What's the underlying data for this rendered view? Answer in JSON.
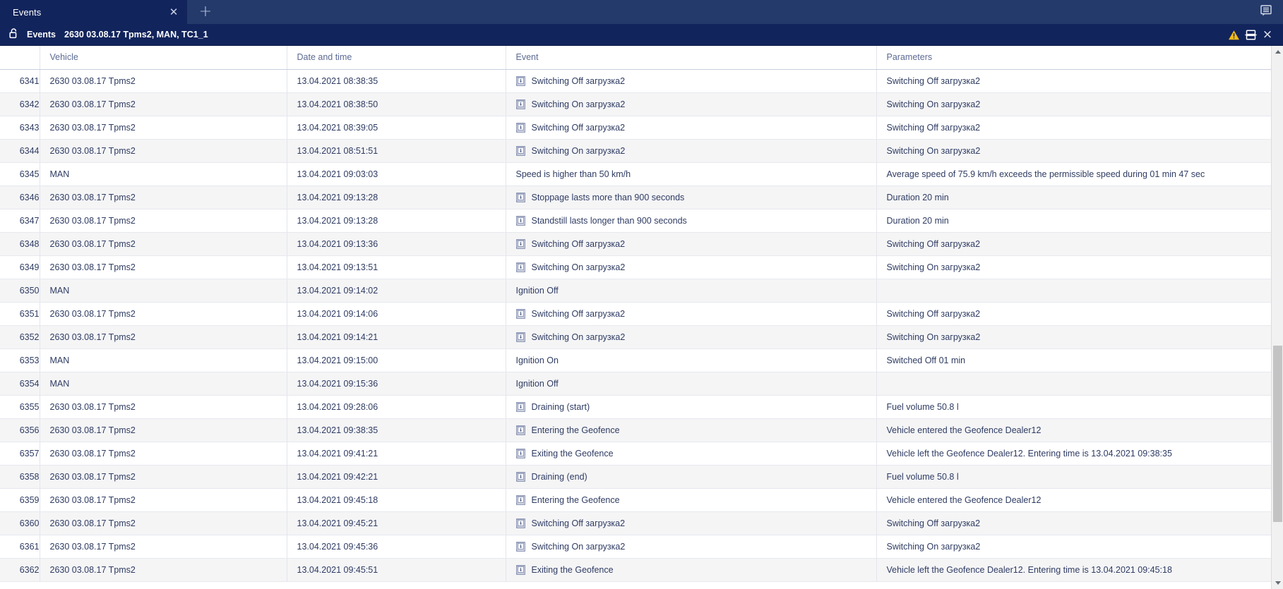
{
  "tabbar": {
    "tabs": [
      {
        "label": "Events",
        "close_icon": "close-icon",
        "active": true
      }
    ],
    "new_tab_icon": "plus-icon",
    "panel_toggle_icon": "panel-toggle-icon"
  },
  "titlebar": {
    "lock_icon": "unlocked-padlock-icon",
    "title": "Events",
    "subtitle": "2630 03.08.17 Tpms2, MAN, TC1_1",
    "warning_icon": "warning-triangle-icon",
    "layout_icon": "split-layout-icon",
    "close_icon": "close-icon",
    "close_label": "×"
  },
  "colors": {
    "tabbar_bg": "#243a6b",
    "tab_active_bg": "#12245c",
    "titlebar_bg": "#12245c",
    "text_on_dark": "#ffffff",
    "header_text": "#5d6a93",
    "cell_text": "#2f3c63",
    "row_even_bg": "#f5f5f6",
    "row_odd_bg": "#ffffff",
    "warning_yellow": "#f5bc18",
    "scroll_thumb": "#c3c3c3"
  },
  "table": {
    "columns": [
      {
        "key": "id",
        "label": ""
      },
      {
        "key": "vehicle",
        "label": "Vehicle"
      },
      {
        "key": "datetime",
        "label": "Date and time"
      },
      {
        "key": "event",
        "label": "Event"
      },
      {
        "key": "parameters",
        "label": "Parameters"
      }
    ],
    "rows": [
      {
        "id": "6341",
        "vehicle": "2630 03.08.17 Tpms2",
        "datetime": "13.04.2021 08:38:35",
        "icon": "sensor-event-icon",
        "event": "Switching Off загрузка2",
        "parameters": "Switching Off загрузка2"
      },
      {
        "id": "6342",
        "vehicle": "2630 03.08.17 Tpms2",
        "datetime": "13.04.2021 08:38:50",
        "icon": "sensor-event-icon",
        "event": "Switching On загрузка2",
        "parameters": "Switching On загрузка2"
      },
      {
        "id": "6343",
        "vehicle": "2630 03.08.17 Tpms2",
        "datetime": "13.04.2021 08:39:05",
        "icon": "sensor-event-icon",
        "event": "Switching Off загрузка2",
        "parameters": "Switching Off загрузка2"
      },
      {
        "id": "6344",
        "vehicle": "2630 03.08.17 Tpms2",
        "datetime": "13.04.2021 08:51:51",
        "icon": "sensor-event-icon",
        "event": "Switching On загрузка2",
        "parameters": "Switching On загрузка2"
      },
      {
        "id": "6345",
        "vehicle": "MAN",
        "datetime": "13.04.2021 09:03:03",
        "icon": "",
        "event": "Speed is higher than 50 km/h",
        "parameters": "Average speed of 75.9 km/h exceeds the permissible speed during 01 min 47 sec"
      },
      {
        "id": "6346",
        "vehicle": "2630 03.08.17 Tpms2",
        "datetime": "13.04.2021 09:13:28",
        "icon": "sensor-event-icon",
        "event": "Stoppage lasts more than 900 seconds",
        "parameters": "Duration 20 min"
      },
      {
        "id": "6347",
        "vehicle": "2630 03.08.17 Tpms2",
        "datetime": "13.04.2021 09:13:28",
        "icon": "sensor-event-icon",
        "event": "Standstill lasts longer than 900 seconds",
        "parameters": "Duration 20 min"
      },
      {
        "id": "6348",
        "vehicle": "2630 03.08.17 Tpms2",
        "datetime": "13.04.2021 09:13:36",
        "icon": "sensor-event-icon",
        "event": "Switching Off загрузка2",
        "parameters": "Switching Off загрузка2"
      },
      {
        "id": "6349",
        "vehicle": "2630 03.08.17 Tpms2",
        "datetime": "13.04.2021 09:13:51",
        "icon": "sensor-event-icon",
        "event": "Switching On загрузка2",
        "parameters": "Switching On загрузка2"
      },
      {
        "id": "6350",
        "vehicle": "MAN",
        "datetime": "13.04.2021 09:14:02",
        "icon": "",
        "event": "Ignition Off",
        "parameters": ""
      },
      {
        "id": "6351",
        "vehicle": "2630 03.08.17 Tpms2",
        "datetime": "13.04.2021 09:14:06",
        "icon": "sensor-event-icon",
        "event": "Switching Off загрузка2",
        "parameters": "Switching Off загрузка2"
      },
      {
        "id": "6352",
        "vehicle": "2630 03.08.17 Tpms2",
        "datetime": "13.04.2021 09:14:21",
        "icon": "sensor-event-icon",
        "event": "Switching On загрузка2",
        "parameters": "Switching On загрузка2"
      },
      {
        "id": "6353",
        "vehicle": "MAN",
        "datetime": "13.04.2021 09:15:00",
        "icon": "",
        "event": "Ignition On",
        "parameters": "Switched Off 01 min"
      },
      {
        "id": "6354",
        "vehicle": "MAN",
        "datetime": "13.04.2021 09:15:36",
        "icon": "",
        "event": "Ignition Off",
        "parameters": ""
      },
      {
        "id": "6355",
        "vehicle": "2630 03.08.17 Tpms2",
        "datetime": "13.04.2021 09:28:06",
        "icon": "sensor-event-icon",
        "event": "Draining (start)",
        "parameters": "Fuel volume 50.8 l"
      },
      {
        "id": "6356",
        "vehicle": "2630 03.08.17 Tpms2",
        "datetime": "13.04.2021 09:38:35",
        "icon": "sensor-event-icon",
        "event": "Entering the Geofence",
        "parameters": "Vehicle entered the Geofence Dealer12"
      },
      {
        "id": "6357",
        "vehicle": "2630 03.08.17 Tpms2",
        "datetime": "13.04.2021 09:41:21",
        "icon": "sensor-event-icon",
        "event": "Exiting the Geofence",
        "parameters": "Vehicle left the Geofence Dealer12. Entering time is 13.04.2021 09:38:35"
      },
      {
        "id": "6358",
        "vehicle": "2630 03.08.17 Tpms2",
        "datetime": "13.04.2021 09:42:21",
        "icon": "sensor-event-icon",
        "event": "Draining (end)",
        "parameters": "Fuel volume 50.8 l"
      },
      {
        "id": "6359",
        "vehicle": "2630 03.08.17 Tpms2",
        "datetime": "13.04.2021 09:45:18",
        "icon": "sensor-event-icon",
        "event": "Entering the Geofence",
        "parameters": "Vehicle entered the Geofence Dealer12"
      },
      {
        "id": "6360",
        "vehicle": "2630 03.08.17 Tpms2",
        "datetime": "13.04.2021 09:45:21",
        "icon": "sensor-event-icon",
        "event": "Switching Off загрузка2",
        "parameters": "Switching Off загрузка2"
      },
      {
        "id": "6361",
        "vehicle": "2630 03.08.17 Tpms2",
        "datetime": "13.04.2021 09:45:36",
        "icon": "sensor-event-icon",
        "event": "Switching On загрузка2",
        "parameters": "Switching On загрузка2"
      },
      {
        "id": "6362",
        "vehicle": "2630 03.08.17 Tpms2",
        "datetime": "13.04.2021 09:45:51",
        "icon": "sensor-event-icon",
        "event": "Exiting the Geofence",
        "parameters": "Vehicle left the Geofence Dealer12. Entering time is 13.04.2021 09:45:18"
      }
    ]
  },
  "scrollbar": {
    "up_icon": "scroll-up-arrow-icon",
    "down_icon": "scroll-down-arrow-icon",
    "thumb_name": "scroll-thumb"
  }
}
